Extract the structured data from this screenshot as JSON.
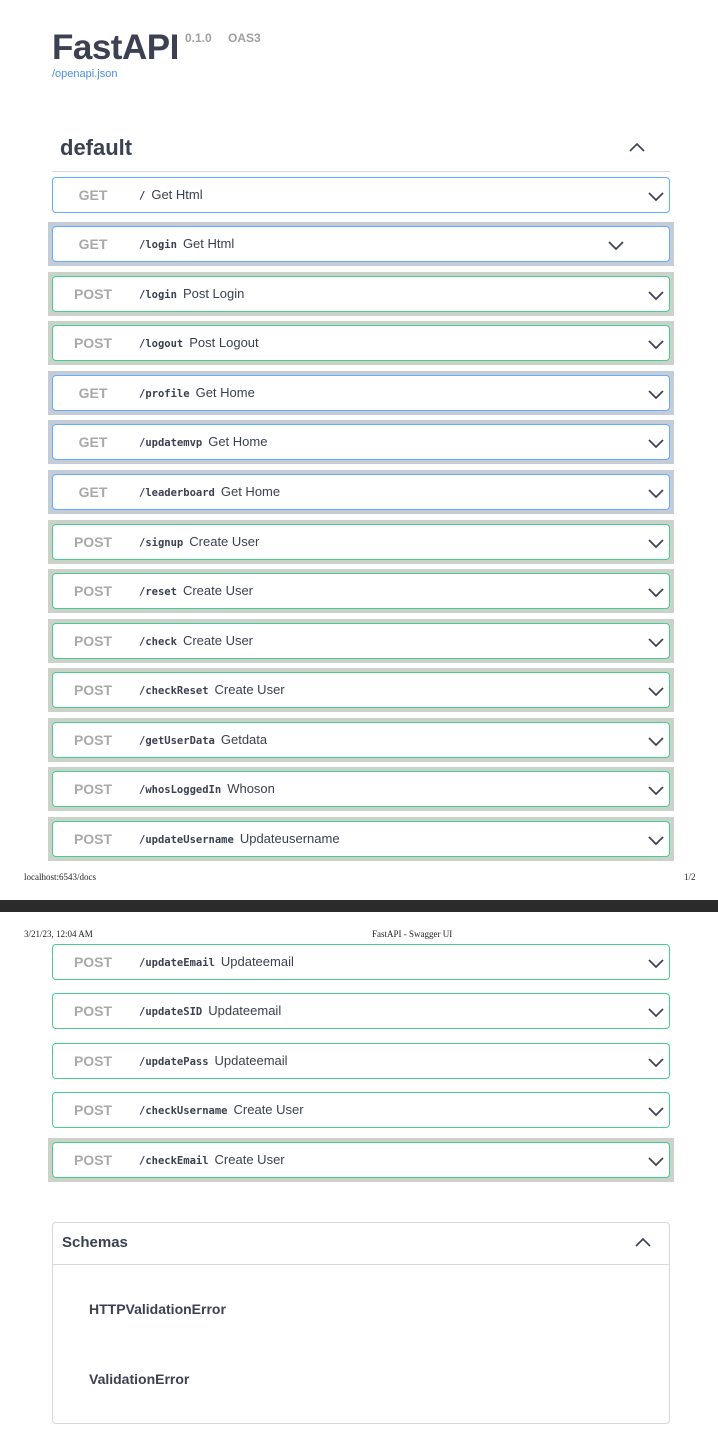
{
  "app": {
    "title": "FastAPI",
    "version": "0.1.0",
    "spec_badge": "OAS3",
    "spec_link": "/openapi.json"
  },
  "section": {
    "title": "default"
  },
  "operations_page1": [
    {
      "method": "GET",
      "path": "/",
      "summary": "Get Html"
    },
    {
      "method": "GET",
      "path": "/login",
      "summary": "Get Html"
    },
    {
      "method": "POST",
      "path": "/login",
      "summary": "Post Login"
    },
    {
      "method": "POST",
      "path": "/logout",
      "summary": "Post Logout"
    },
    {
      "method": "GET",
      "path": "/profile",
      "summary": "Get Home"
    },
    {
      "method": "GET",
      "path": "/updatemvp",
      "summary": "Get Home"
    },
    {
      "method": "GET",
      "path": "/leaderboard",
      "summary": "Get Home"
    },
    {
      "method": "POST",
      "path": "/signup",
      "summary": "Create User"
    },
    {
      "method": "POST",
      "path": "/reset",
      "summary": "Create User"
    },
    {
      "method": "POST",
      "path": "/check",
      "summary": "Create User"
    },
    {
      "method": "POST",
      "path": "/checkReset",
      "summary": "Create User"
    },
    {
      "method": "POST",
      "path": "/getUserData",
      "summary": "Getdata"
    },
    {
      "method": "POST",
      "path": "/whosLoggedIn",
      "summary": "Whoson"
    },
    {
      "method": "POST",
      "path": "/updateUsername",
      "summary": "Updateusername"
    }
  ],
  "operations_page2": [
    {
      "method": "POST",
      "path": "/updateEmail",
      "summary": "Updateemail"
    },
    {
      "method": "POST",
      "path": "/updateSID",
      "summary": "Updateemail"
    },
    {
      "method": "POST",
      "path": "/updatePass",
      "summary": "Updateemail"
    },
    {
      "method": "POST",
      "path": "/checkUsername",
      "summary": "Create User"
    },
    {
      "method": "POST",
      "path": "/checkEmail",
      "summary": "Create User"
    }
  ],
  "print": {
    "footer_left": "localhost:6543/docs",
    "footer_right": "1/2",
    "header_left": "3/21/23, 12:04 AM",
    "header_center": "FastAPI - Swagger UI"
  },
  "schemas": {
    "title": "Schemas",
    "models": [
      "HTTPValidationError",
      "ValidationError"
    ]
  },
  "colors": {
    "get_border": "#61affe",
    "post_border": "#49cc90",
    "method_text": "#a9a9a9"
  }
}
